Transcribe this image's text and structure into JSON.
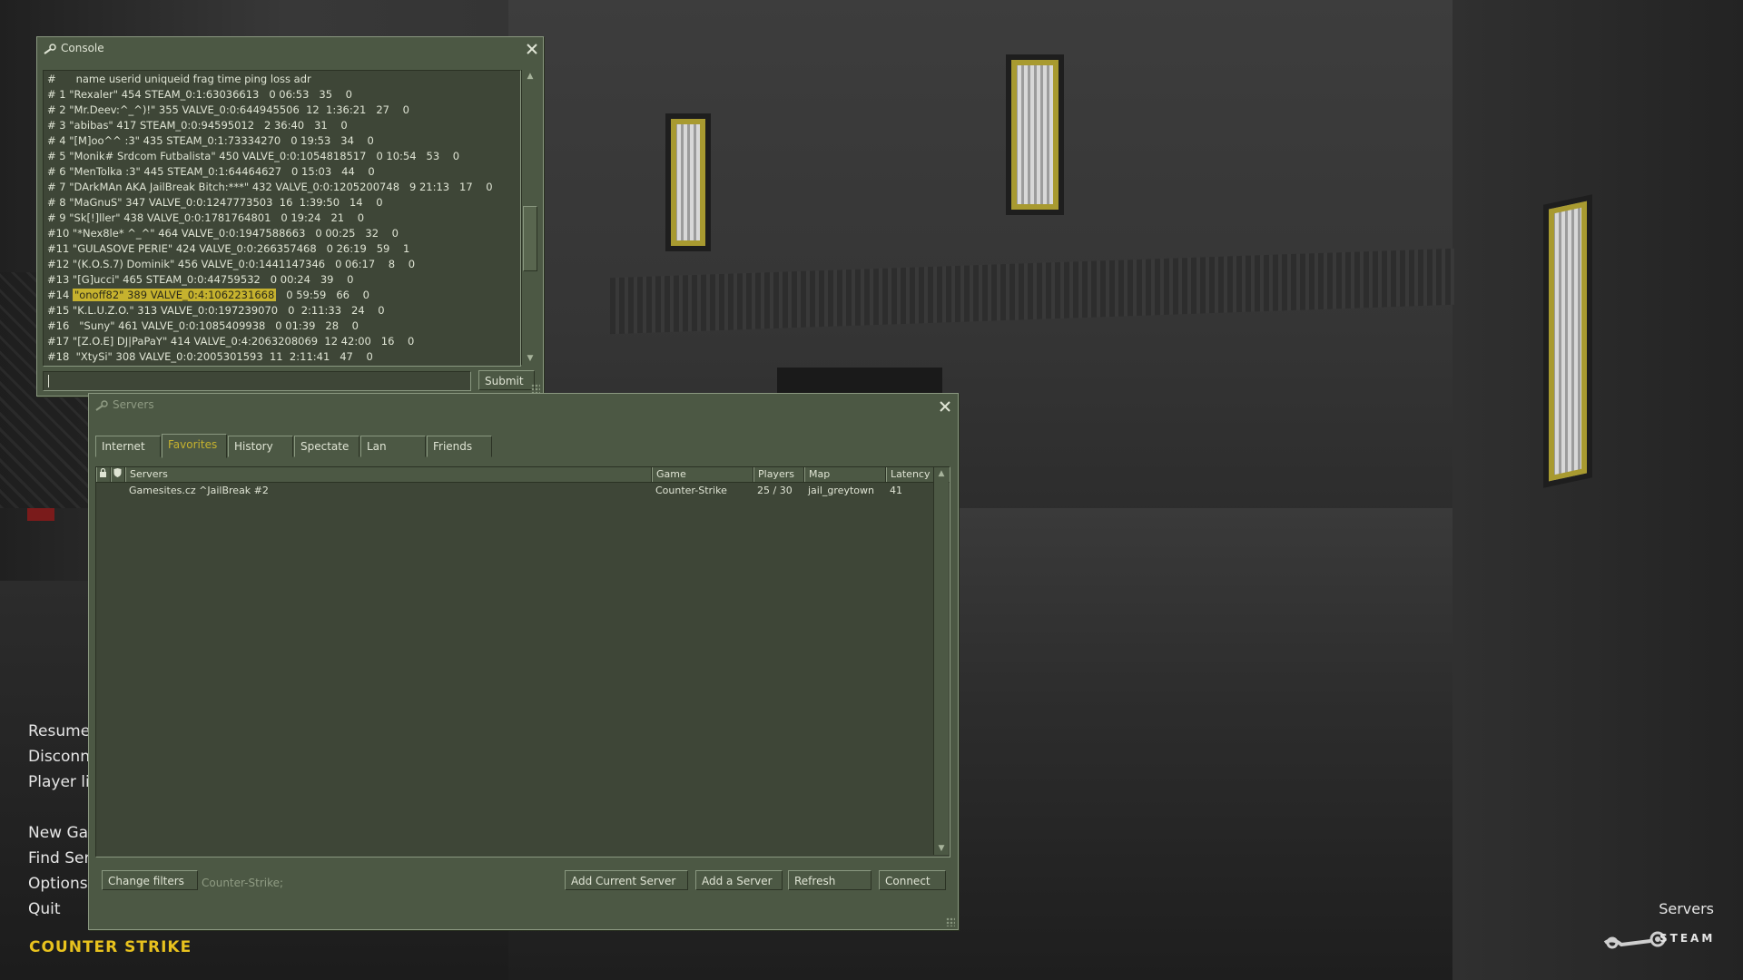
{
  "main_menu": {
    "items": [
      "Resume",
      "Disconn",
      "Player li",
      "New Ga",
      "Find Ser",
      "Options",
      "Quit"
    ]
  },
  "game_logo": "COUNTER STRIKE",
  "bottom_right": {
    "label": "Servers",
    "steam_text": "STEAM"
  },
  "console": {
    "title": "Console",
    "lines": [
      "#      name userid uniqueid frag time ping loss adr",
      "# 1 \"Rexaler\" 454 STEAM_0:1:63036613   0 06:53   35    0",
      "# 2 \"Mr.Deev:^_^)!\" 355 VALVE_0:0:644945506  12  1:36:21   27    0",
      "# 3 \"abibas\" 417 STEAM_0:0:94595012   2 36:40   31    0",
      "# 4 \"[M]oo^^ :3\" 435 STEAM_0:1:73334270   0 19:53   34    0",
      "# 5 \"Monik# Srdcom Futbalista\" 450 VALVE_0:0:1054818517   0 10:54   53    0",
      "# 6 \"MenTolka :3\" 445 STEAM_0:1:64464627   0 15:03   44    0",
      "# 7 \"DArkMAn AKA JailBreak Bitch:***\" 432 VALVE_0:0:1205200748   9 21:13   17    0",
      "# 8 \"MaGnuS\" 347 VALVE_0:0:1247773503  16  1:39:50   14    0",
      "# 9 \"Sk[!]ller\" 438 VALVE_0:0:1781764801   0 19:24   21    0",
      "#10 \"*Nex8le* ^_^\" 464 VALVE_0:0:1947588663   0 00:25   32    0",
      "#11 \"GULASOVE PERIE\" 424 VALVE_0:0:266357468   0 26:19   59    1",
      "#12 \"(K.O.S.7) Dominik\" 456 VALVE_0:0:1441147346   0 06:17    8    0",
      "#13 \"[G]ucci\" 465 STEAM_0:0:44759532   0 00:24   39    0",
      "#15 \"K.L.U.Z.O.\" 313 VALVE_0:0:197239070   0  2:11:33   24    0",
      "#16   \"Suny\" 461 VALVE_0:0:1085409938   0 01:39   28    0",
      "#17 \"[Z.O.E] DJ|PaPaY\" 414 VALVE_0:4:2063208069  12 42:00   16    0",
      "#18  \"XtySi\" 308 VALVE_0:0:2005301593  11  2:11:41   47    0"
    ],
    "highlight_line": {
      "prefix": "#14 ",
      "selected": "\"onoff82\" 389 VALVE_0:4:1062231668",
      "suffix": "   0 59:59   66    0"
    },
    "input_value": "",
    "submit_label": "Submit"
  },
  "servers": {
    "title": "Servers",
    "tabs": [
      "Internet",
      "Favorites",
      "History",
      "Spectate",
      "Lan",
      "Friends"
    ],
    "active_tab": "Favorites",
    "columns": {
      "servers": "Servers",
      "game": "Game",
      "players": "Players",
      "map": "Map",
      "latency": "Latency"
    },
    "rows": [
      {
        "name": "Gamesites.cz ^JailBreak #2",
        "game": "Counter-Strike",
        "players": "25 / 30",
        "map": "jail_greytown",
        "latency": "41"
      }
    ],
    "buttons": {
      "change_filters": "Change filters",
      "add_current": "Add Current Server",
      "add_server": "Add a Server",
      "refresh": "Refresh",
      "connect": "Connect"
    },
    "filter_text": "Counter-Strike;"
  },
  "colors": {
    "panel": "#4c5844",
    "highlight": "#c6b22e",
    "logo": "#e8c21e"
  }
}
